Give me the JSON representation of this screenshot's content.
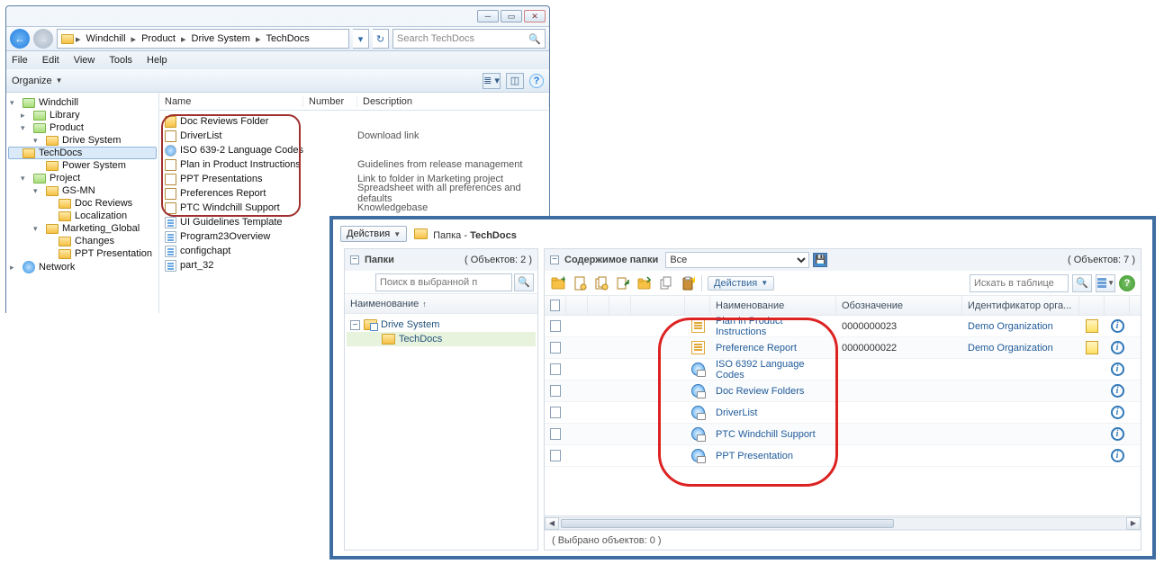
{
  "explorer": {
    "breadcrumb": [
      "Windchill",
      "Product",
      "Drive System",
      "TechDocs"
    ],
    "search_placeholder": "Search TechDocs",
    "menu": [
      "File",
      "Edit",
      "View",
      "Tools",
      "Help"
    ],
    "organize": "Organize",
    "columns": {
      "name": "Name",
      "number": "Number",
      "description": "Description"
    },
    "tree": [
      {
        "label": "Windchill",
        "indent": 0,
        "tri": "▾",
        "icon": "folder-g"
      },
      {
        "label": "Library",
        "indent": 1,
        "tri": "▸",
        "icon": "folder-g"
      },
      {
        "label": "Product",
        "indent": 1,
        "tri": "▾",
        "icon": "folder-g"
      },
      {
        "label": "Drive System",
        "indent": 2,
        "tri": "▾",
        "icon": "folder"
      },
      {
        "label": "TechDocs",
        "indent": 3,
        "tri": "",
        "icon": "folder",
        "sel": true
      },
      {
        "label": "Power System",
        "indent": 2,
        "tri": "",
        "icon": "folder"
      },
      {
        "label": "Project",
        "indent": 1,
        "tri": "▾",
        "icon": "folder-g"
      },
      {
        "label": "GS-MN",
        "indent": 2,
        "tri": "▾",
        "icon": "folder"
      },
      {
        "label": "Doc Reviews",
        "indent": 3,
        "tri": "",
        "icon": "folder"
      },
      {
        "label": "Localization",
        "indent": 3,
        "tri": "",
        "icon": "folder"
      },
      {
        "label": "Marketing_Global",
        "indent": 2,
        "tri": "▾",
        "icon": "folder"
      },
      {
        "label": "Changes",
        "indent": 3,
        "tri": "",
        "icon": "folder"
      },
      {
        "label": "PPT Presentation",
        "indent": 3,
        "tri": "",
        "icon": "folder"
      },
      {
        "label": "Network",
        "indent": 0,
        "tri": "▸",
        "icon": "net"
      }
    ],
    "files": [
      {
        "name": "Doc Reviews Folder",
        "icon": "d",
        "desc": ""
      },
      {
        "name": "DriverList",
        "icon": "l",
        "desc": "Download link"
      },
      {
        "name": "ISO 639-2 Language Codes",
        "icon": "g",
        "desc": ""
      },
      {
        "name": "Plan in Product Instructions",
        "icon": "l",
        "desc": "Guidelines from release management"
      },
      {
        "name": "PPT Presentations",
        "icon": "l",
        "desc": "Link to folder in Marketing project"
      },
      {
        "name": "Preferences Report",
        "icon": "l",
        "desc": "Spreadsheet with all preferences and defaults"
      },
      {
        "name": "PTC Windchill Support",
        "icon": "l",
        "desc": "Knowledgebase"
      },
      {
        "name": "UI Guidelines Template",
        "icon": "t",
        "desc": ""
      },
      {
        "name": "Program23Overview",
        "icon": "t",
        "desc": ""
      },
      {
        "name": "configchapt",
        "icon": "t",
        "desc": ""
      },
      {
        "name": "part_32",
        "icon": "t",
        "desc": ""
      }
    ]
  },
  "windchill": {
    "actions_top": "Действия",
    "title_prefix": "Папка - ",
    "title_name": "TechDocs",
    "left": {
      "title": "Папки",
      "count": "( Объектов: 2 )",
      "search_placeholder": "Поиск в выбранной п",
      "col_name": "Наименование",
      "tree": [
        {
          "label": "Drive System",
          "toggle": "−",
          "icon": "link",
          "sel": false,
          "indent": 0
        },
        {
          "label": "TechDocs",
          "toggle": "",
          "icon": "plain",
          "sel": true,
          "indent": 1
        }
      ]
    },
    "right": {
      "title": "Содержимое папки",
      "filter": "Все",
      "count": "( Объектов: 7 )",
      "actions": "Действия",
      "search_placeholder": "Искать в таблице",
      "columns": {
        "name": "Наименование",
        "desig": "Обозначение",
        "org": "Идентификатор орга..."
      },
      "rows": [
        {
          "type": "doc",
          "name": "Plan in Product Instructions",
          "desig": "0000000023",
          "org": "Demo Organization",
          "flag": true
        },
        {
          "type": "doc",
          "name": "Preference Report",
          "desig": "0000000022",
          "org": "Demo Organization",
          "flag": true
        },
        {
          "type": "globe",
          "name": "ISO 6392 Language Codes",
          "desig": "",
          "org": "",
          "flag": false
        },
        {
          "type": "globe",
          "name": "Doc Review Folders",
          "desig": "",
          "org": "",
          "flag": false
        },
        {
          "type": "globe",
          "name": "DriverList",
          "desig": "",
          "org": "",
          "flag": false
        },
        {
          "type": "globe",
          "name": "PTC Windchill Support",
          "desig": "",
          "org": "",
          "flag": false
        },
        {
          "type": "globe",
          "name": "PPT Presentation",
          "desig": "",
          "org": "",
          "flag": false
        }
      ],
      "status": "( Выбрано объектов: 0 )"
    }
  }
}
